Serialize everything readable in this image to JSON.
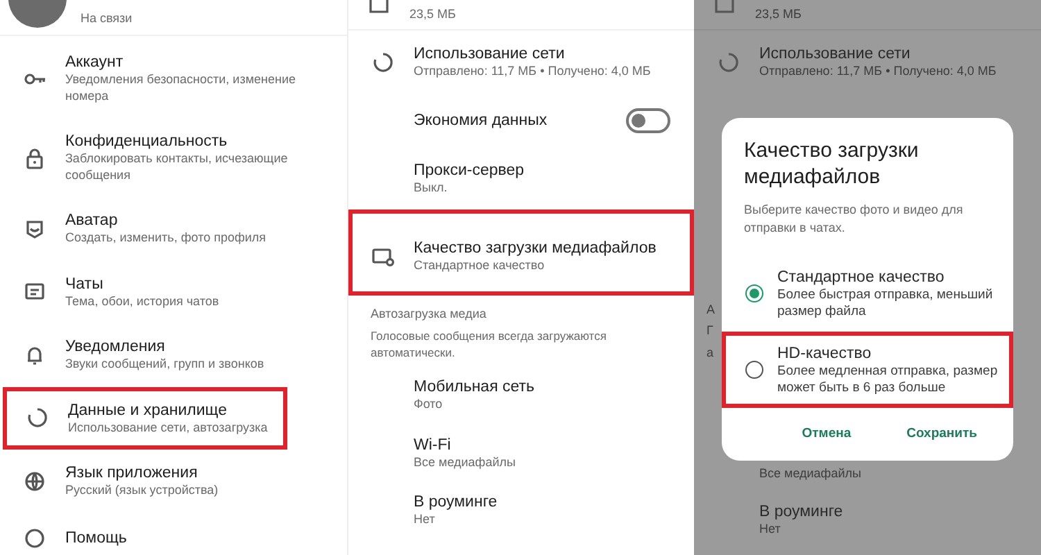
{
  "settings_menu": {
    "profile": {
      "status": "На связи"
    },
    "items": [
      {
        "title": "Аккаунт",
        "subtitle": "Уведомления безопасности, изменение номера",
        "highlighted": false
      },
      {
        "title": "Конфиденциальность",
        "subtitle": "Заблокировать контакты, исчезающие сообщения",
        "highlighted": false
      },
      {
        "title": "Аватар",
        "subtitle": "Создать, изменить, фото профиля",
        "highlighted": false
      },
      {
        "title": "Чаты",
        "subtitle": "Тема, обои, история чатов",
        "highlighted": false
      },
      {
        "title": "Уведомления",
        "subtitle": "Звуки сообщений, групп и звонков",
        "highlighted": false
      },
      {
        "title": "Данные и хранилище",
        "subtitle": "Использование сети, автозагрузка",
        "highlighted": true
      },
      {
        "title": "Язык приложения",
        "subtitle": "Русский (язык устройства)",
        "highlighted": false
      },
      {
        "title": "Помощь",
        "highlighted": false
      }
    ]
  },
  "data_storage": {
    "storage_size": "23,5 МБ",
    "items": [
      {
        "kind": "link",
        "title": "Использование сети",
        "subtitle": "Отправлено: 11,7 МБ • Получено: 4,0 МБ",
        "highlighted": false
      },
      {
        "kind": "toggle",
        "title": "Экономия данных",
        "on": false
      },
      {
        "kind": "link",
        "title": "Прокси-сервер",
        "subtitle": "Выкл.",
        "highlighted": false
      },
      {
        "kind": "link",
        "title": "Качество загрузки медиафайлов",
        "subtitle": "Стандартное качество",
        "highlighted": true
      }
    ],
    "media_section": {
      "title": "Автозагрузка медиа",
      "description": "Голосовые сообщения всегда загружаются автоматически.",
      "items": [
        {
          "title": "Мобильная сеть",
          "subtitle": "Фото"
        },
        {
          "title": "Wi-Fi",
          "subtitle": "Все медиафайлы"
        },
        {
          "title": "В роуминге",
          "subtitle": "Нет"
        }
      ]
    }
  },
  "dialog_screen": {
    "background": {
      "storage_size": "23,5 МБ",
      "network_title": "Использование сети",
      "network_subtitle": "Отправлено: 11,7 МБ • Получено: 4,0 МБ",
      "fragments": [
        "А",
        "Г",
        "а"
      ],
      "wifi_subtitle": "Все медиафайлы",
      "roaming_title": "В роуминге",
      "roaming_subtitle": "Нет"
    },
    "dialog": {
      "title": "Качество загрузки медиафайлов",
      "description": "Выберите качество фото и видео для отправки в чатах.",
      "options": [
        {
          "title": "Стандартное качество",
          "subtitle": "Более быстрая отправка, меньший размер файла",
          "selected": true,
          "highlighted": false
        },
        {
          "title": "HD-качество",
          "subtitle": "Более медленная отправка, размер может быть в 6 раз больше",
          "selected": false,
          "highlighted": true
        }
      ],
      "buttons": [
        "Отмена",
        "Сохранить"
      ]
    }
  }
}
